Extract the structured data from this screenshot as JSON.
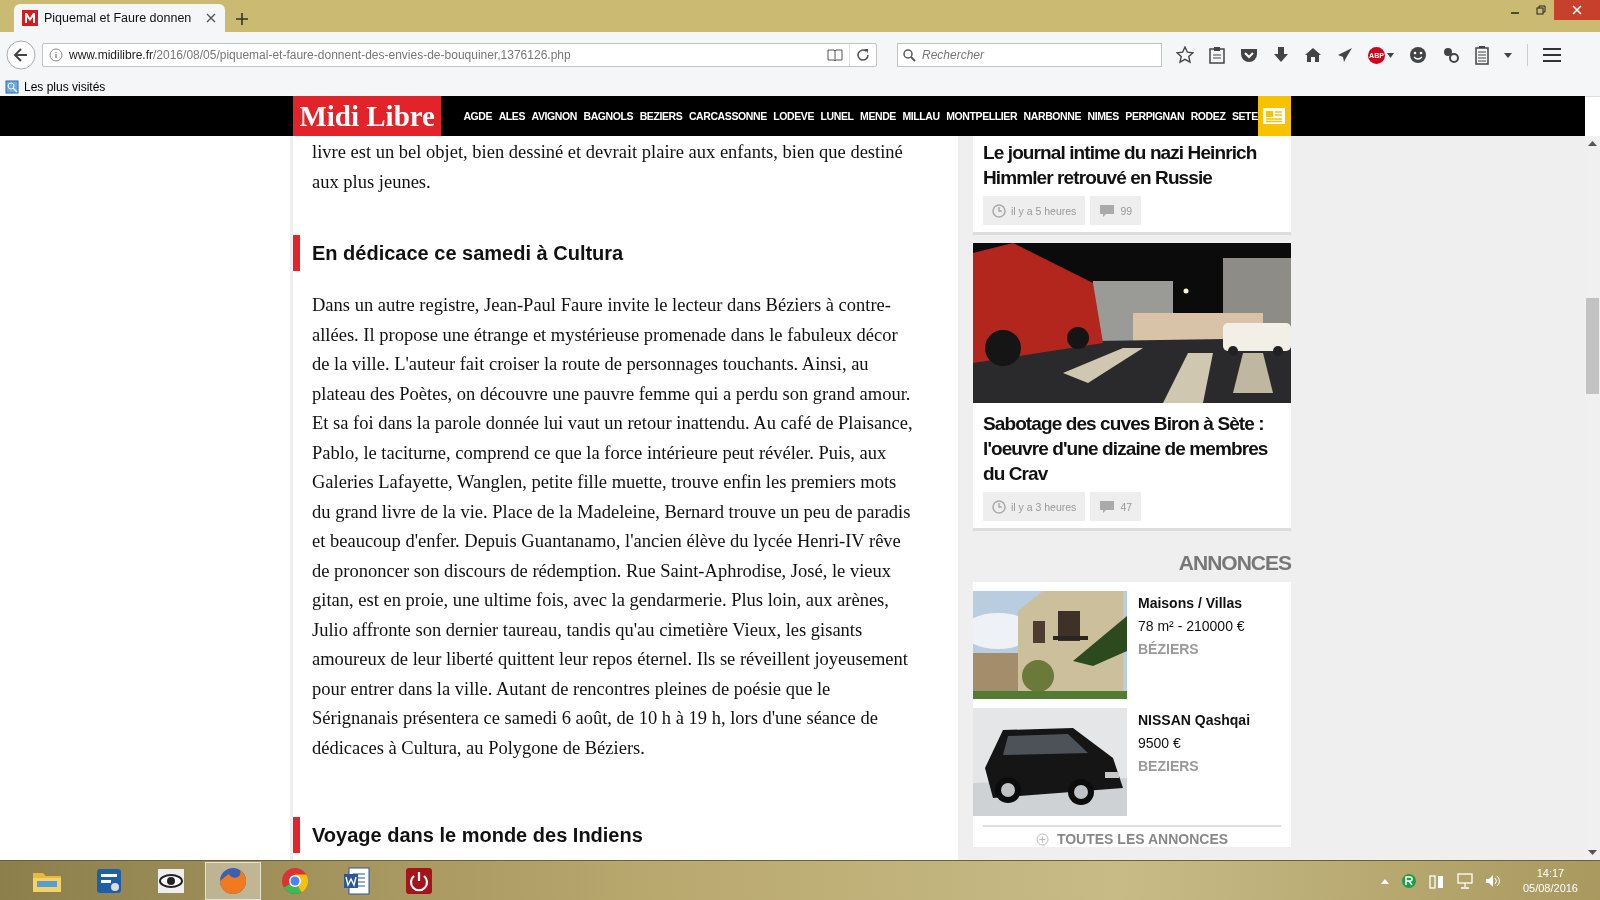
{
  "tabs": [
    {
      "title": "Piquemal et Faure donnen",
      "selected": true
    }
  ],
  "address_bar": {
    "domain": "www.midilibre.fr",
    "path": "/2016/08/05/piquemal-et-faure-donnent-des-envies-de-bouquiner,1376126.php"
  },
  "search": {
    "placeholder": "Rechercher"
  },
  "toolbar": {
    "adblock_label": "ABP"
  },
  "bookmarks": [
    "Les plus visités"
  ],
  "site": {
    "logo": "Midi Libre",
    "nav": [
      "AGDE",
      "ALES",
      "AVIGNON",
      "BAGNOLS",
      "BEZIERS",
      "CARCASSONNE",
      "LODEVE",
      "LUNEL",
      "MENDE",
      "MILLAU",
      "MONTPELLIER",
      "NARBONNE",
      "NIMES",
      "PERPIGNAN",
      "RODEZ",
      "SETE"
    ]
  },
  "article": {
    "blocks": [
      {
        "kind": "paragraph",
        "text": "livre est un bel objet, bien dessiné et devrait plaire aux enfants, bien que destiné aux plus jeunes."
      },
      {
        "kind": "heading",
        "text": "En dédicace ce samedi à Cultura"
      },
      {
        "kind": "paragraph",
        "text": "Dans un autre registre, Jean-Paul Faure invite le lecteur dans Béziers à contre-allées. Il propose une étrange et mystérieuse promenade dans le fabuleux décor de la ville. L'auteur fait croiser la route de personnages touchants. Ainsi, au plateau des Poètes, on découvre une pauvre femme qui a perdu son grand amour. Et sa foi dans la parole donnée lui vaut un retour inattendu. Au café de Plaisance, Pablo, le taciturne, comprend ce que la force intérieure peut révéler. Puis, aux Galeries Lafayette, Wanglen, petite fille muette, trouve enfin les premiers mots du grand livre de la vie. Place de la Madeleine, Bernard trouve un peu de paradis et beaucoup d'enfer. Depuis Guantanamo, l'ancien élève du lycée Henri-IV rêve de prononcer son discours de rédemption. Rue Saint-Aphrodise, José, le vieux gitan, est en proie, une ultime fois, avec la gendarmerie. Plus loin, aux arènes, Julio affronte son dernier taureau, tandis qu'au cimetière Vieux, les gisants amoureux de leur liberté quittent leur repos éternel. Ils se réveillent joyeusement pour entrer dans la ville. Autant de rencontres pleines de poésie que le Sérignanais présentera ce samedi 6 août, de 10 h à 19 h, lors d'une séance de dédicaces à Cultura, au Polygone de Béziers."
      },
      {
        "kind": "heading",
        "text": "Voyage dans le monde des Indiens"
      }
    ]
  },
  "sidebar": {
    "news": [
      {
        "title": "Le journal intime du nazi Heinrich Himmler retrouvé en Russie",
        "time": "il y a 5 heures",
        "comments": "99"
      },
      {
        "kind": "picture",
        "title": "Sabotage des cuves Biron à Sète : l'oeuvre d'une dizaine de membres du Crav",
        "time": "il y a 3 heures",
        "comments": "47"
      }
    ],
    "ads_title": "ANNONCES",
    "ads": [
      {
        "kind": "picture",
        "title": "Maisons / Villas",
        "detail": "78 m² - 210000 €",
        "place": "BÉZIERS"
      },
      {
        "kind": "picture",
        "title": "NISSAN Qashqai",
        "detail": "9500 €",
        "place": "BEZIERS"
      }
    ],
    "all_ads": "TOUTES LES ANNONCES"
  },
  "taskbar": {
    "apps": [
      {
        "kind": "folder",
        "selected": false
      },
      {
        "kind": "settings",
        "selected": false
      },
      {
        "kind": "eye",
        "selected": false
      },
      {
        "kind": "firefox",
        "selected": true
      },
      {
        "kind": "chrome",
        "selected": false
      },
      {
        "kind": "word",
        "selected": false
      },
      {
        "kind": "power",
        "selected": false
      }
    ],
    "clock": {
      "time": "14:17",
      "date": "05/08/2016"
    }
  }
}
